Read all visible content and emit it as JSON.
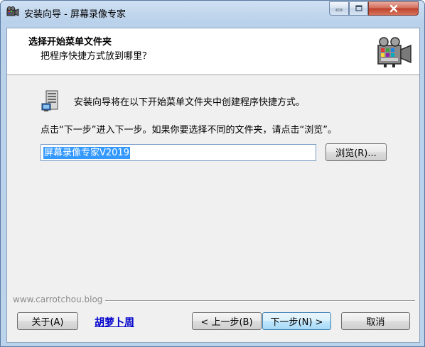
{
  "window": {
    "title": "安装向导 - 屏幕录像专家",
    "app_icon": "camera-icon",
    "controls": {
      "minimize_icon": "minimize-icon",
      "maximize_icon": "maximize-icon",
      "close_icon": "close-icon"
    }
  },
  "header": {
    "title": "选择开始菜单文件夹",
    "subtitle": "把程序快捷方式放到哪里？",
    "icon": "video-camera-icon"
  },
  "body": {
    "folder_icon": "program-group-icon",
    "intro_text": "安装向导将在以下开始菜单文件夹中创建程序快捷方式。",
    "instruction_text": "点击“下一步”进入下一步。如果你要选择不同的文件夹，请点击“浏览”。",
    "folder_value": "屏幕录像专家V2019",
    "browse_label": "浏览(R)..."
  },
  "footer": {
    "watermark": "www.carrotchou.blog",
    "about_label": "关于(A)",
    "link_text": "胡萝卜周",
    "back_label": "< 上一步(B)",
    "next_label": "下一步(N) >",
    "cancel_label": "取消"
  },
  "colors": {
    "selection": "#3399ff",
    "link": "#0000cc",
    "close_button": "#c0412b",
    "title_bar": "#b9d1ea"
  }
}
